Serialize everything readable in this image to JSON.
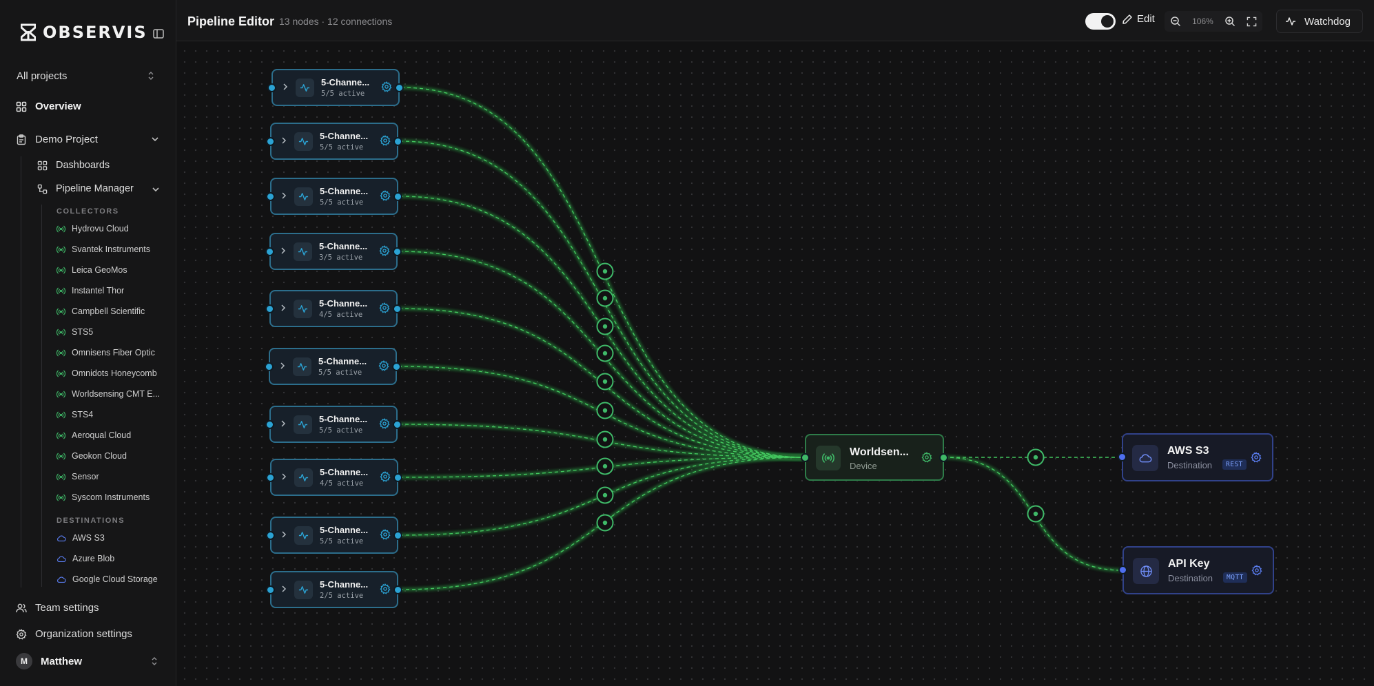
{
  "brand": {
    "name": "OBSERVIS"
  },
  "sidebar": {
    "project_select": "All projects",
    "overview": "Overview",
    "project": "Demo Project",
    "dashboards": "Dashboards",
    "pipeline_manager": "Pipeline Manager",
    "collectors_title": "COLLECTORS",
    "collectors": [
      "Hydrovu Cloud",
      "Svantek Instruments",
      "Leica GeoMos",
      "Instantel Thor",
      "Campbell Scientific",
      "STS5",
      "Omnisens Fiber Optic",
      "Omnidots Honeycomb",
      "Worldsensing CMT E...",
      "STS4",
      "Aeroqual Cloud",
      "Geokon Cloud",
      "Sensor",
      "Syscom Instruments"
    ],
    "destinations_title": "DESTINATIONS",
    "destinations": [
      "AWS S3",
      "Azure Blob",
      "Google Cloud Storage"
    ],
    "team_settings": "Team settings",
    "org_settings": "Organization settings",
    "user": {
      "initial": "M",
      "name": "Matthew"
    }
  },
  "topbar": {
    "title": "Pipeline Editor",
    "subtitle": "13 nodes · 12 connections",
    "edit_label": "Edit",
    "edit_mode": true,
    "zoom": "106%",
    "watchdog_label": "Watchdog"
  },
  "pipeline": {
    "sources": [
      {
        "title": "5-Channe...",
        "status": "5/5 active"
      },
      {
        "title": "5-Channe...",
        "status": "5/5 active"
      },
      {
        "title": "5-Channe...",
        "status": "5/5 active"
      },
      {
        "title": "5-Channe...",
        "status": "3/5 active"
      },
      {
        "title": "5-Channe...",
        "status": "4/5 active"
      },
      {
        "title": "5-Channe...",
        "status": "5/5 active"
      },
      {
        "title": "5-Channe...",
        "status": "5/5 active"
      },
      {
        "title": "5-Channe...",
        "status": "4/5 active"
      },
      {
        "title": "5-Channe...",
        "status": "5/5 active"
      },
      {
        "title": "5-Channe...",
        "status": "2/5 active"
      }
    ],
    "device": {
      "title": "Worldsen...",
      "type": "Device"
    },
    "destinations": [
      {
        "title": "AWS S3",
        "type": "Destination",
        "protocol": "REST",
        "icon": "cloud-icon"
      },
      {
        "title": "API Key",
        "type": "Destination",
        "protocol": "MQTT",
        "icon": "globe-icon"
      }
    ]
  },
  "colors": {
    "source": "#2ba3d4",
    "device": "#3fb968",
    "destination": "#4f6ff0",
    "wire": "#3ec45a"
  }
}
